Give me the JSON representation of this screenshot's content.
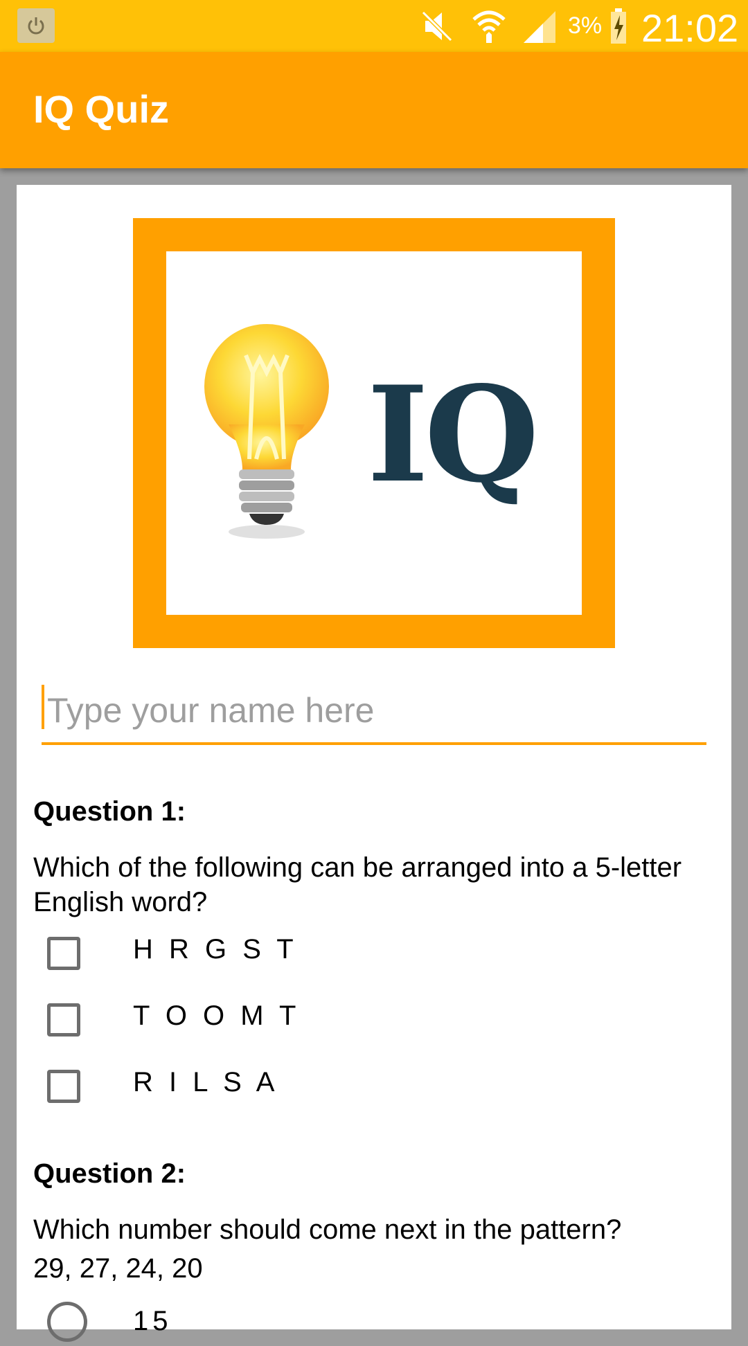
{
  "status_bar": {
    "icons": [
      "power-icon",
      "mute-icon",
      "wifi-icon",
      "signal-icon",
      "battery-charging-icon"
    ],
    "battery_percent": "3%",
    "time": "21:02"
  },
  "app_bar": {
    "title": "IQ Quiz"
  },
  "logo": {
    "text": "IQ",
    "accent_color": "#ffa000",
    "text_color": "#1b3a4b"
  },
  "name_field": {
    "placeholder": "Type your name here",
    "value": ""
  },
  "questions": [
    {
      "title": "Question 1:",
      "text": "Which of the following can be arranged into a 5-letter English word?",
      "input_type": "checkbox",
      "options": [
        "H R G S T",
        "T O O M T",
        "R I L S A"
      ]
    },
    {
      "title": "Question 2:",
      "text": "Which number should come next in the pattern?",
      "text_line2": "29, 27, 24, 20",
      "input_type": "radio",
      "options": [
        "15"
      ]
    }
  ],
  "colors": {
    "status_bar": "#ffc107",
    "app_bar": "#ffa000",
    "background": "#9e9e9e"
  }
}
